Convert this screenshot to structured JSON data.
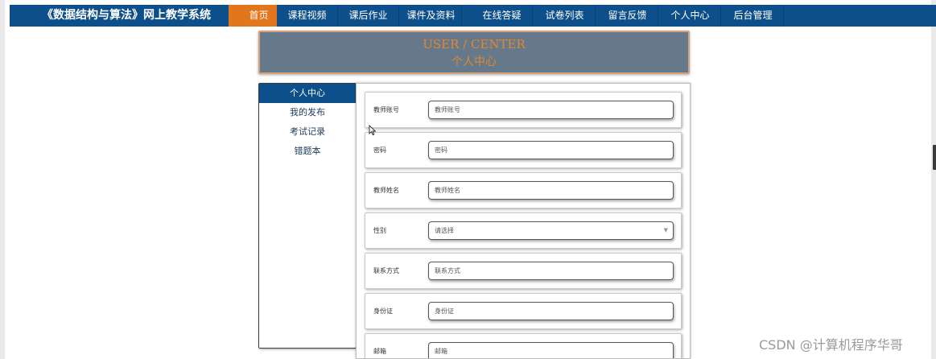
{
  "brand": "《数据结构与算法》网上教学系统",
  "nav": [
    {
      "label": "首页",
      "active": true
    },
    {
      "label": "课程视频",
      "active": false
    },
    {
      "label": "课后作业",
      "active": false
    },
    {
      "label": "课件及资料",
      "active": false
    },
    {
      "label": "在线答疑",
      "active": false
    },
    {
      "label": "试卷列表",
      "active": false
    },
    {
      "label": "留言反馈",
      "active": false
    },
    {
      "label": "个人中心",
      "active": false
    },
    {
      "label": "后台管理",
      "active": false
    }
  ],
  "banner": {
    "en": "USER / CENTER",
    "cn": "个人中心"
  },
  "sidebar": [
    {
      "label": "个人中心",
      "active": true
    },
    {
      "label": "我的发布",
      "active": false
    },
    {
      "label": "考试记录",
      "active": false
    },
    {
      "label": "错题本",
      "active": false
    }
  ],
  "form": [
    {
      "label": "教师账号",
      "placeholder": "教师账号",
      "type": "text"
    },
    {
      "label": "密码",
      "placeholder": "密码",
      "type": "text"
    },
    {
      "label": "教师姓名",
      "placeholder": "教师姓名",
      "type": "text"
    },
    {
      "label": "性别",
      "placeholder": "请选择",
      "type": "select"
    },
    {
      "label": "联系方式",
      "placeholder": "联系方式",
      "type": "text"
    },
    {
      "label": "身份证",
      "placeholder": "身份证",
      "type": "text"
    },
    {
      "label": "邮箱",
      "placeholder": "邮箱",
      "type": "text"
    }
  ],
  "watermark": "CSDN @计算机程序华哥",
  "colors": {
    "nav_bg": "#0d4f8a",
    "nav_active": "#e2761c",
    "banner_bg": "#66798a",
    "banner_text": "#e2872f"
  },
  "icons": {
    "cursor": "mouse-pointer-icon",
    "select_caret": "chevron-down-icon"
  }
}
